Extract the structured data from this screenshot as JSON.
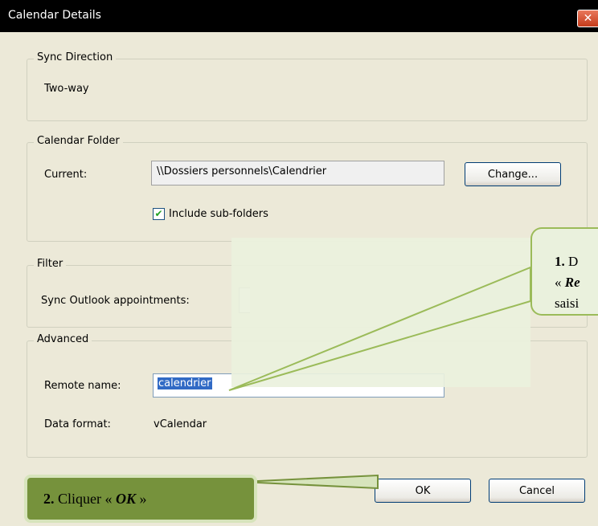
{
  "window": {
    "title": "Calendar Details"
  },
  "sync_direction": {
    "legend": "Sync Direction",
    "value": "Two-way"
  },
  "calendar_folder": {
    "legend": "Calendar Folder",
    "current_label": "Current:",
    "current_value": "\\\\Dossiers personnels\\Calendrier",
    "change_button": "Change...",
    "include_subfolders_label": "Include sub-folders",
    "include_subfolders_checked": true
  },
  "filter": {
    "legend": "Filter",
    "sync_label": "Sync Outlook appointments:"
  },
  "advanced": {
    "legend": "Advanced",
    "remote_name_label": "Remote name:",
    "remote_name_value": "calendrier",
    "data_format_label": "Data format:",
    "data_format_value": "vCalendar"
  },
  "buttons": {
    "ok": "OK",
    "cancel": "Cancel"
  },
  "callouts": {
    "c1_num": "1.",
    "c1_l1a": "D",
    "c1_l2a": "« ",
    "c1_l2b": "Re",
    "c1_l3": "saisi",
    "c2_num": "2.",
    "c2_text": " Cliquer « ",
    "c2_ok": "OK",
    "c2_end": " »"
  },
  "colors": {
    "dialog_bg": "#ece9d8",
    "callout_fill": "#eaf1dd",
    "callout_border": "#9bbb59",
    "callout2_fill": "#76923c",
    "selection": "#316ac5"
  }
}
